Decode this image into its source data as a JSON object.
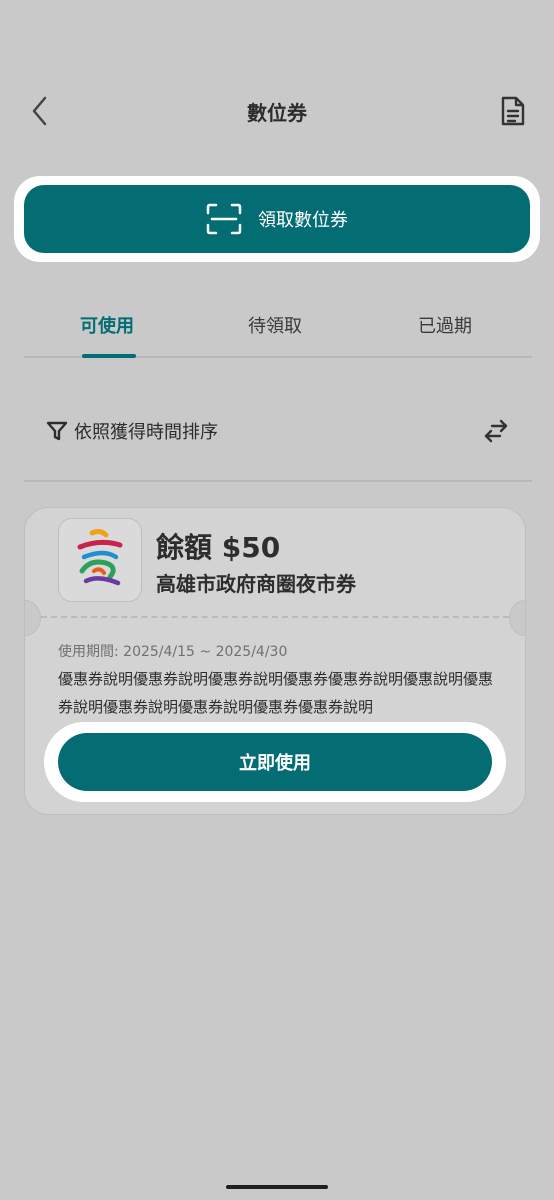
{
  "header": {
    "title": "數位券",
    "back_icon": "chevron-left-icon",
    "action_icon": "document-list-icon"
  },
  "claim_button": {
    "label": "領取數位券",
    "icon": "scan-icon"
  },
  "tabs": [
    {
      "label": "可使用",
      "active": true
    },
    {
      "label": "待領取",
      "active": false
    },
    {
      "label": "已過期",
      "active": false
    }
  ],
  "sort": {
    "label": "依照獲得時間排序",
    "filter_icon": "filter-icon",
    "swap_icon": "swap-arrows-icon"
  },
  "coupon": {
    "balance": "餘額 $50",
    "name": "高雄市政府商圈夜市券",
    "usage_period": "使用期間: 2025/4/15 ~ 2025/4/30",
    "description": "優惠券說明優惠券說明優惠券說明優惠券優惠券說明優惠說明優惠券說明優惠券說明優惠券說明優惠券優惠券說明",
    "use_label": "立即使用",
    "logo_icon": "kaohsiung-logo-icon"
  },
  "colors": {
    "accent": "#046d74",
    "background": "#c8c9c8"
  }
}
